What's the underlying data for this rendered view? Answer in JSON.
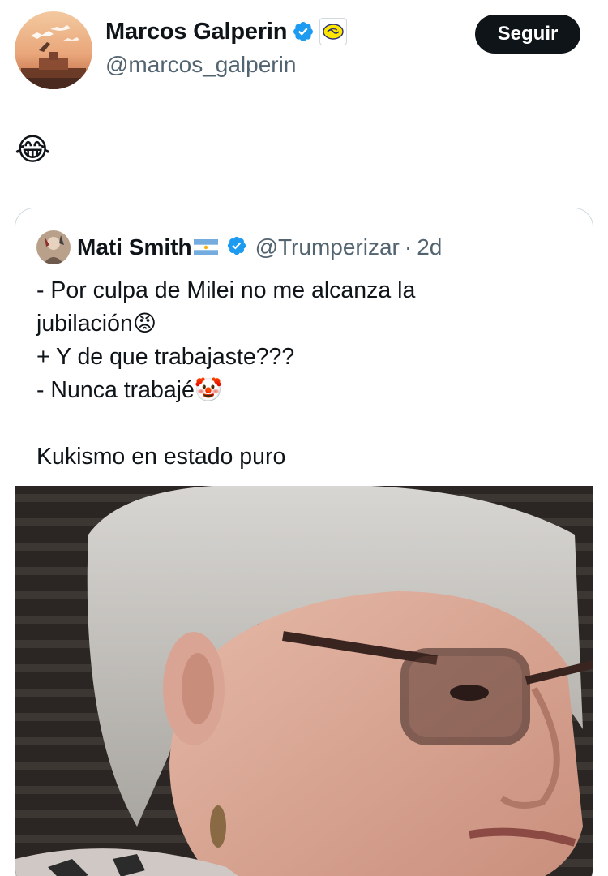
{
  "tweet": {
    "author": {
      "name": "Marcos Galperin",
      "handle": "@marcos_galperin",
      "verified": true,
      "affiliation_icon": "handshake-badge-icon"
    },
    "follow_label": "Seguir",
    "text": "😂"
  },
  "quoted": {
    "author": {
      "name": "Mati Smith",
      "flag_icon": "argentina-flag-icon",
      "handle": "@Trumperizar",
      "verified": true
    },
    "separator": "·",
    "time": "2d",
    "lines": [
      {
        "text": "- Por culpa de Milei no me alcanza la",
        "emoji": ""
      },
      {
        "text": "jubilación",
        "emoji": "😡"
      },
      {
        "text": "+ Y de que trabajaste???",
        "emoji": ""
      },
      {
        "text": "- Nunca trabajé",
        "emoji": "🤡"
      },
      {
        "text": "",
        "emoji": ""
      },
      {
        "text": "Kukismo en estado puro",
        "emoji": ""
      }
    ],
    "media_type": "video-frame"
  },
  "colors": {
    "text_primary": "#0f1419",
    "text_secondary": "#536471",
    "verified_blue": "#1d9bf0",
    "follow_bg": "#0f1419",
    "card_border": "#cfd9de"
  }
}
